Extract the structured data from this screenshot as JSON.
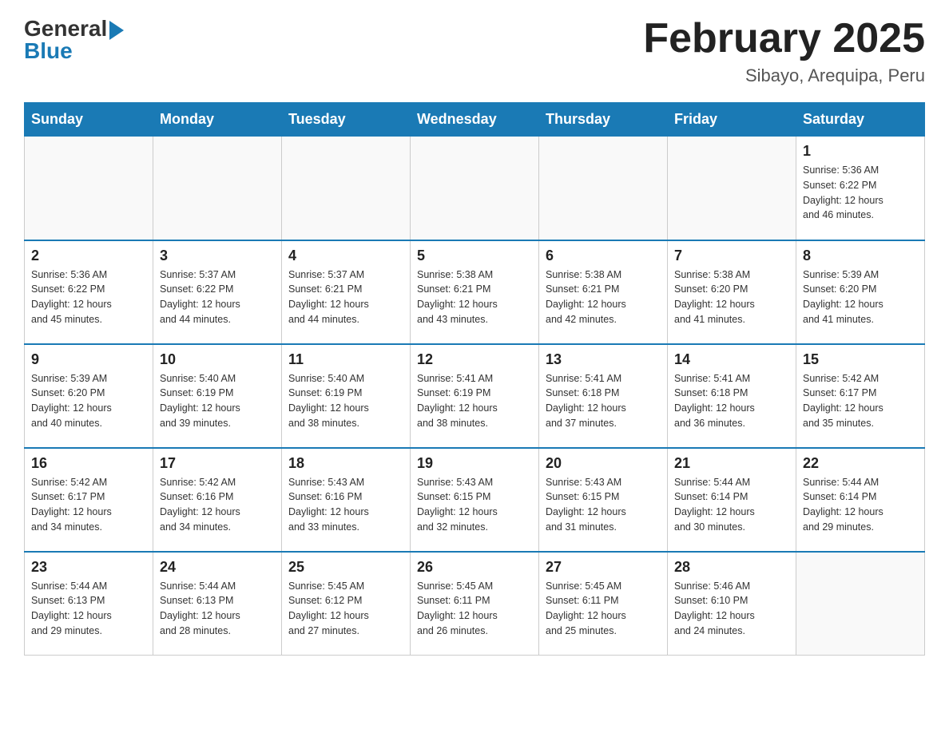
{
  "header": {
    "logo_general": "General",
    "logo_blue": "Blue",
    "month_title": "February 2025",
    "subtitle": "Sibayo, Arequipa, Peru"
  },
  "weekdays": [
    "Sunday",
    "Monday",
    "Tuesday",
    "Wednesday",
    "Thursday",
    "Friday",
    "Saturday"
  ],
  "weeks": [
    [
      {
        "day": "",
        "info": ""
      },
      {
        "day": "",
        "info": ""
      },
      {
        "day": "",
        "info": ""
      },
      {
        "day": "",
        "info": ""
      },
      {
        "day": "",
        "info": ""
      },
      {
        "day": "",
        "info": ""
      },
      {
        "day": "1",
        "info": "Sunrise: 5:36 AM\nSunset: 6:22 PM\nDaylight: 12 hours\nand 46 minutes."
      }
    ],
    [
      {
        "day": "2",
        "info": "Sunrise: 5:36 AM\nSunset: 6:22 PM\nDaylight: 12 hours\nand 45 minutes."
      },
      {
        "day": "3",
        "info": "Sunrise: 5:37 AM\nSunset: 6:22 PM\nDaylight: 12 hours\nand 44 minutes."
      },
      {
        "day": "4",
        "info": "Sunrise: 5:37 AM\nSunset: 6:21 PM\nDaylight: 12 hours\nand 44 minutes."
      },
      {
        "day": "5",
        "info": "Sunrise: 5:38 AM\nSunset: 6:21 PM\nDaylight: 12 hours\nand 43 minutes."
      },
      {
        "day": "6",
        "info": "Sunrise: 5:38 AM\nSunset: 6:21 PM\nDaylight: 12 hours\nand 42 minutes."
      },
      {
        "day": "7",
        "info": "Sunrise: 5:38 AM\nSunset: 6:20 PM\nDaylight: 12 hours\nand 41 minutes."
      },
      {
        "day": "8",
        "info": "Sunrise: 5:39 AM\nSunset: 6:20 PM\nDaylight: 12 hours\nand 41 minutes."
      }
    ],
    [
      {
        "day": "9",
        "info": "Sunrise: 5:39 AM\nSunset: 6:20 PM\nDaylight: 12 hours\nand 40 minutes."
      },
      {
        "day": "10",
        "info": "Sunrise: 5:40 AM\nSunset: 6:19 PM\nDaylight: 12 hours\nand 39 minutes."
      },
      {
        "day": "11",
        "info": "Sunrise: 5:40 AM\nSunset: 6:19 PM\nDaylight: 12 hours\nand 38 minutes."
      },
      {
        "day": "12",
        "info": "Sunrise: 5:41 AM\nSunset: 6:19 PM\nDaylight: 12 hours\nand 38 minutes."
      },
      {
        "day": "13",
        "info": "Sunrise: 5:41 AM\nSunset: 6:18 PM\nDaylight: 12 hours\nand 37 minutes."
      },
      {
        "day": "14",
        "info": "Sunrise: 5:41 AM\nSunset: 6:18 PM\nDaylight: 12 hours\nand 36 minutes."
      },
      {
        "day": "15",
        "info": "Sunrise: 5:42 AM\nSunset: 6:17 PM\nDaylight: 12 hours\nand 35 minutes."
      }
    ],
    [
      {
        "day": "16",
        "info": "Sunrise: 5:42 AM\nSunset: 6:17 PM\nDaylight: 12 hours\nand 34 minutes."
      },
      {
        "day": "17",
        "info": "Sunrise: 5:42 AM\nSunset: 6:16 PM\nDaylight: 12 hours\nand 34 minutes."
      },
      {
        "day": "18",
        "info": "Sunrise: 5:43 AM\nSunset: 6:16 PM\nDaylight: 12 hours\nand 33 minutes."
      },
      {
        "day": "19",
        "info": "Sunrise: 5:43 AM\nSunset: 6:15 PM\nDaylight: 12 hours\nand 32 minutes."
      },
      {
        "day": "20",
        "info": "Sunrise: 5:43 AM\nSunset: 6:15 PM\nDaylight: 12 hours\nand 31 minutes."
      },
      {
        "day": "21",
        "info": "Sunrise: 5:44 AM\nSunset: 6:14 PM\nDaylight: 12 hours\nand 30 minutes."
      },
      {
        "day": "22",
        "info": "Sunrise: 5:44 AM\nSunset: 6:14 PM\nDaylight: 12 hours\nand 29 minutes."
      }
    ],
    [
      {
        "day": "23",
        "info": "Sunrise: 5:44 AM\nSunset: 6:13 PM\nDaylight: 12 hours\nand 29 minutes."
      },
      {
        "day": "24",
        "info": "Sunrise: 5:44 AM\nSunset: 6:13 PM\nDaylight: 12 hours\nand 28 minutes."
      },
      {
        "day": "25",
        "info": "Sunrise: 5:45 AM\nSunset: 6:12 PM\nDaylight: 12 hours\nand 27 minutes."
      },
      {
        "day": "26",
        "info": "Sunrise: 5:45 AM\nSunset: 6:11 PM\nDaylight: 12 hours\nand 26 minutes."
      },
      {
        "day": "27",
        "info": "Sunrise: 5:45 AM\nSunset: 6:11 PM\nDaylight: 12 hours\nand 25 minutes."
      },
      {
        "day": "28",
        "info": "Sunrise: 5:46 AM\nSunset: 6:10 PM\nDaylight: 12 hours\nand 24 minutes."
      },
      {
        "day": "",
        "info": ""
      }
    ]
  ]
}
